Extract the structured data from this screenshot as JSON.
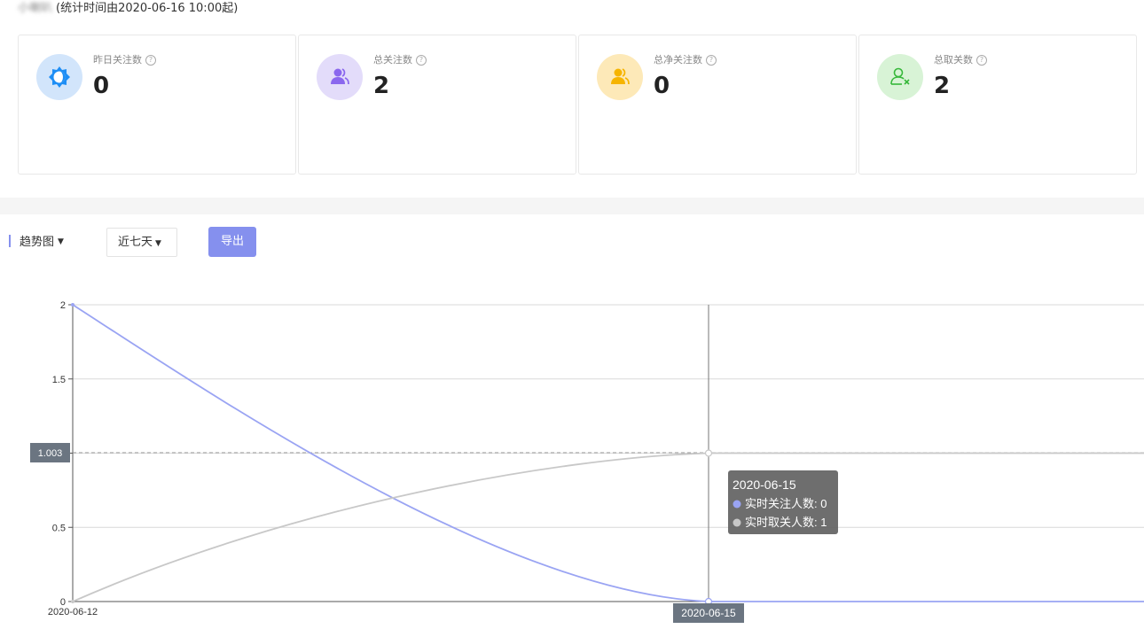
{
  "header": {
    "account_name": "小喇叭",
    "stat_note": "(统计时间由2020-06-16 10:00起)"
  },
  "cards": [
    {
      "label": "昨日关注数",
      "value": "0",
      "icon": "sun-icon",
      "icon_bg": "#d2e5fb",
      "icon_color": "#1e8ef5"
    },
    {
      "label": "总关注数",
      "value": "2",
      "icon": "users-icon",
      "icon_bg": "#e3dcfa",
      "icon_color": "#8a67ee"
    },
    {
      "label": "总净关注数",
      "value": "0",
      "icon": "users-icon",
      "icon_bg": "#fde9b8",
      "icon_color": "#f6b400"
    },
    {
      "label": "总取关数",
      "value": "2",
      "icon": "user-remove-icon",
      "icon_bg": "#d8f3d6",
      "icon_color": "#36b83a"
    }
  ],
  "toolbar": {
    "trend_label": "趋势图",
    "range_value": "近七天",
    "export_label": "导出",
    "accent": "#8590ee"
  },
  "chart_data": {
    "type": "line",
    "x": [
      "2020-06-12",
      "2020-06-15"
    ],
    "x_ticks_labeled": [
      "2020-06-12"
    ],
    "ylim": [
      0,
      2
    ],
    "y_ticks": [
      "0",
      "0.5",
      "1",
      "1.5",
      "2"
    ],
    "series": [
      {
        "name": "实时关注人数",
        "values": [
          2,
          0
        ],
        "color": "#9aa4f3"
      },
      {
        "name": "实时取关人数",
        "values": [
          0,
          1
        ],
        "color": "#c8c8c8"
      }
    ],
    "crosshair": {
      "x_label": "2020-06-15",
      "y_label": "1.003"
    },
    "tooltip": {
      "title": "2020-06-15",
      "rows": [
        "实时关注人数: 0",
        "实时取关人数: 1"
      ]
    }
  }
}
